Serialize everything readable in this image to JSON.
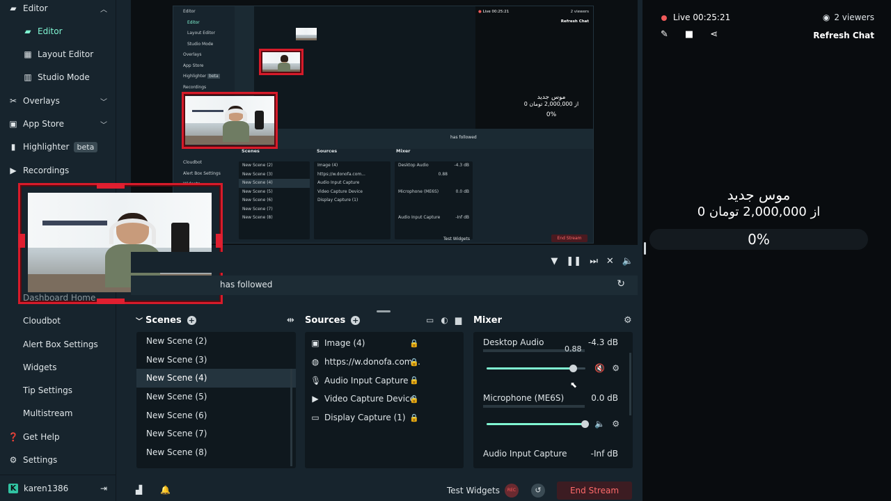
{
  "sidebar": {
    "items": [
      {
        "label": "Editor",
        "icon": "editor-icon",
        "level": "top",
        "expanded": true
      },
      {
        "label": "Editor",
        "icon": "editor-icon",
        "level": "sub",
        "active": true
      },
      {
        "label": "Layout Editor",
        "icon": "layout-icon",
        "level": "sub"
      },
      {
        "label": "Studio Mode",
        "icon": "studio-icon",
        "level": "sub"
      },
      {
        "label": "Overlays",
        "icon": "overlays-icon",
        "level": "top",
        "expanded": false
      },
      {
        "label": "App Store",
        "icon": "store-icon",
        "level": "top",
        "expanded": false
      },
      {
        "label": "Highlighter",
        "icon": "highlighter-icon",
        "level": "top",
        "badge": "beta"
      },
      {
        "label": "Recordings",
        "icon": "recordings-icon",
        "level": "top"
      }
    ],
    "lower_items": [
      {
        "label": "Dashboard Home",
        "level": "sub"
      },
      {
        "label": "Cloudbot",
        "level": "sub"
      },
      {
        "label": "Alert Box Settings",
        "level": "sub"
      },
      {
        "label": "Widgets",
        "level": "sub"
      },
      {
        "label": "Tip Settings",
        "level": "sub"
      },
      {
        "label": "Multistream",
        "level": "sub"
      },
      {
        "label": "Get Help",
        "icon": "help-icon",
        "level": "top"
      },
      {
        "label": "Settings",
        "icon": "gear-icon",
        "level": "top"
      }
    ],
    "user": "karen1386"
  },
  "nested_preview": {
    "sidebar": [
      "Editor",
      "Editor",
      "Layout Editor",
      "Studio Mode",
      "Overlays",
      "App Store",
      "Highlighter",
      "Recordings",
      "",
      "",
      "",
      "",
      "",
      "",
      "Cloudbot",
      "Alert Box Settings",
      "Widgets"
    ],
    "highlighter_badge": "beta",
    "live": "Live 00:25:21",
    "viewers": "2 viewers",
    "refresh": "Refresh Chat",
    "goal_title": "موس جدید",
    "goal_sub": "0 از 2,000,000 تومان",
    "goal_pct": "0%",
    "followed": "has followed",
    "scenes_title": "Scenes",
    "sources_title": "Sources",
    "mixer_title": "Mixer",
    "scenes": [
      "New Scene (2)",
      "New Scene (3)",
      "New Scene (4)",
      "New Scene (5)",
      "New Scene (6)",
      "New Scene (7)",
      "New Scene (8)"
    ],
    "sources": [
      "Image (4)",
      "https://w.donofa.com...",
      "Audio Input Capture",
      "Video Capture Device",
      "Display Capture (1)"
    ],
    "mixer": [
      {
        "name": "Desktop Audio",
        "db": "-4.3 dB",
        "tip": "0.88"
      },
      {
        "name": "Microphone (ME6S)",
        "db": "0.0 dB"
      },
      {
        "name": "Audio Input Capture",
        "db": "-Inf dB"
      }
    ],
    "test_widgets": "Test Widgets",
    "end_stream": "End Stream"
  },
  "activity": {
    "text": "has followed"
  },
  "dock": {
    "scenes_title": "Scenes",
    "sources_title": "Sources",
    "mixer_title": "Mixer",
    "scenes": [
      "New Scene (2)",
      "New Scene (3)",
      "New Scene (4)",
      "New Scene (5)",
      "New Scene (6)",
      "New Scene (7)",
      "New Scene (8)"
    ],
    "selected_scene": "New Scene (4)",
    "sources": [
      {
        "label": "Image (4)",
        "icon": "image-icon"
      },
      {
        "label": "https://w.donofa.com...",
        "icon": "globe-icon"
      },
      {
        "label": "Audio Input Capture",
        "icon": "microphone-icon"
      },
      {
        "label": "Video Capture Device",
        "icon": "camera-icon"
      },
      {
        "label": "Display Capture (1)",
        "icon": "monitor-icon"
      }
    ],
    "mixer": [
      {
        "name": "Desktop Audio",
        "db": "-4.3 dB",
        "tip": "0.88",
        "level": 0.88,
        "muted": true
      },
      {
        "name": "Microphone (ME6S)",
        "db": "0.0 dB",
        "level": 1.0,
        "muted": false
      },
      {
        "name": "Audio Input Capture",
        "db": "-Inf dB"
      }
    ]
  },
  "footer": {
    "test_widgets": "Test Widgets",
    "rec": "REC",
    "end_stream": "End Stream"
  },
  "chat": {
    "live": "Live 00:25:21",
    "viewers": "2 viewers",
    "refresh": "Refresh Chat",
    "goal_title": "موس جدید",
    "goal_sub": "0 از 2,000,000 تومان",
    "goal_pct": "0%"
  },
  "colors": {
    "accent": "#80f5d2",
    "live": "#f05a5a",
    "frame": "#d71b2a",
    "end": "#ff6a6a"
  }
}
